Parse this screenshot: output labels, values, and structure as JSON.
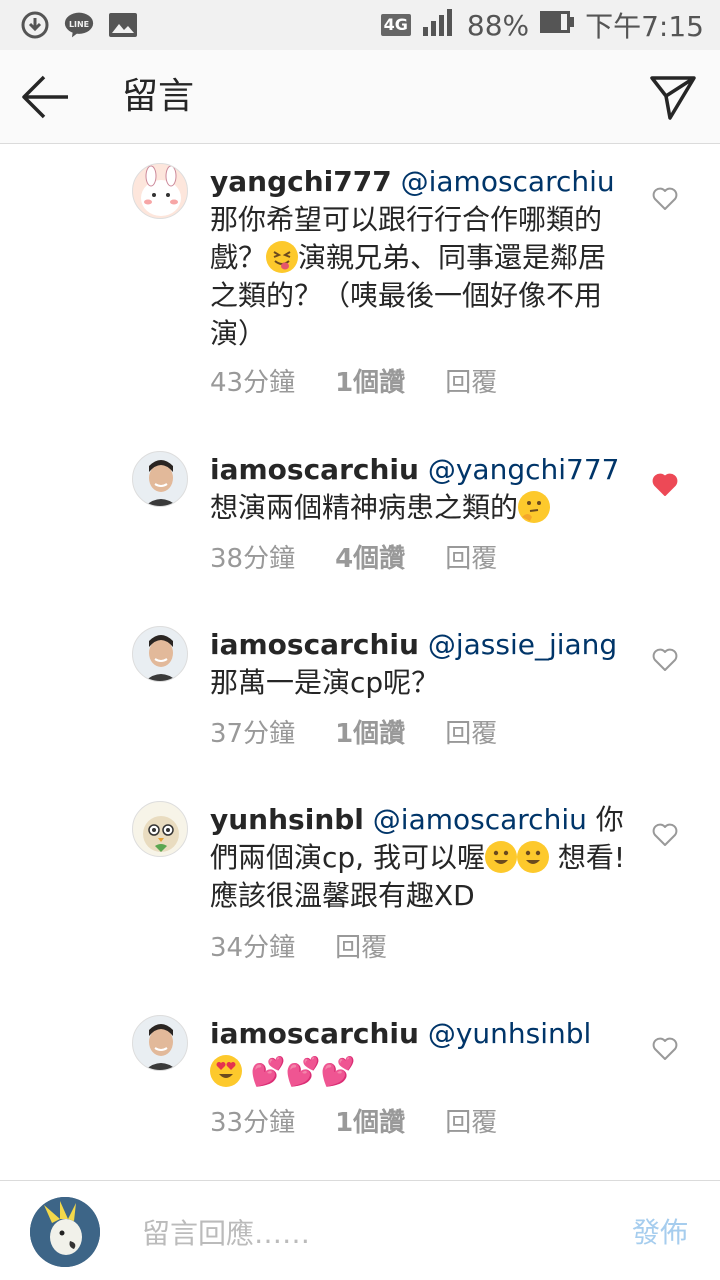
{
  "status_bar": {
    "left_icons": [
      "download-icon",
      "line-app-icon",
      "image-icon"
    ],
    "network": "4G",
    "battery": "88%",
    "time": "下午7:15"
  },
  "header": {
    "title": "留言",
    "back_icon": "arrow-left-icon",
    "send_icon": "paper-plane-icon"
  },
  "comments": [
    {
      "username": "yangchi777",
      "mention": "@iamoscarchiu",
      "text_parts": [
        "那你希望可以跟行行合作哪類的戲？",
        "演親兄弟、同事還是鄰居之類的？（咦最後一個好像不用演）"
      ],
      "time": "43分鐘",
      "likes": "1個讚",
      "reply": "回覆",
      "liked": false
    },
    {
      "username": "iamoscarchiu",
      "mention": "@yangchi777",
      "text_parts": [
        "想演兩個精神病患之類的",
        ""
      ],
      "time": "38分鐘",
      "likes": "4個讚",
      "reply": "回覆",
      "liked": true
    },
    {
      "username": "iamoscarchiu",
      "mention": "@jassie_jiang",
      "text_parts": [
        "那萬一是演cp呢？",
        ""
      ],
      "time": "37分鐘",
      "likes": "1個讚",
      "reply": "回覆",
      "liked": false
    },
    {
      "username": "yunhsinbl",
      "mention": "@iamoscarchiu",
      "text_parts": [
        "你們兩個演cp, 我可以喔",
        "想看! 應該很溫馨跟有趣XD"
      ],
      "time": "34分鐘",
      "likes": "",
      "reply": "回覆",
      "liked": false
    },
    {
      "username": "iamoscarchiu",
      "mention": "@yunhsinbl",
      "text_parts": [
        "",
        ""
      ],
      "time": "33分鐘",
      "likes": "1個讚",
      "reply": "回覆",
      "liked": false
    }
  ],
  "footer": {
    "placeholder": "留言回應……",
    "post_label": "發佈"
  },
  "colors": {
    "mention": "#003569",
    "liked_heart": "#ed4956",
    "post_disabled": "#a6cdee"
  }
}
